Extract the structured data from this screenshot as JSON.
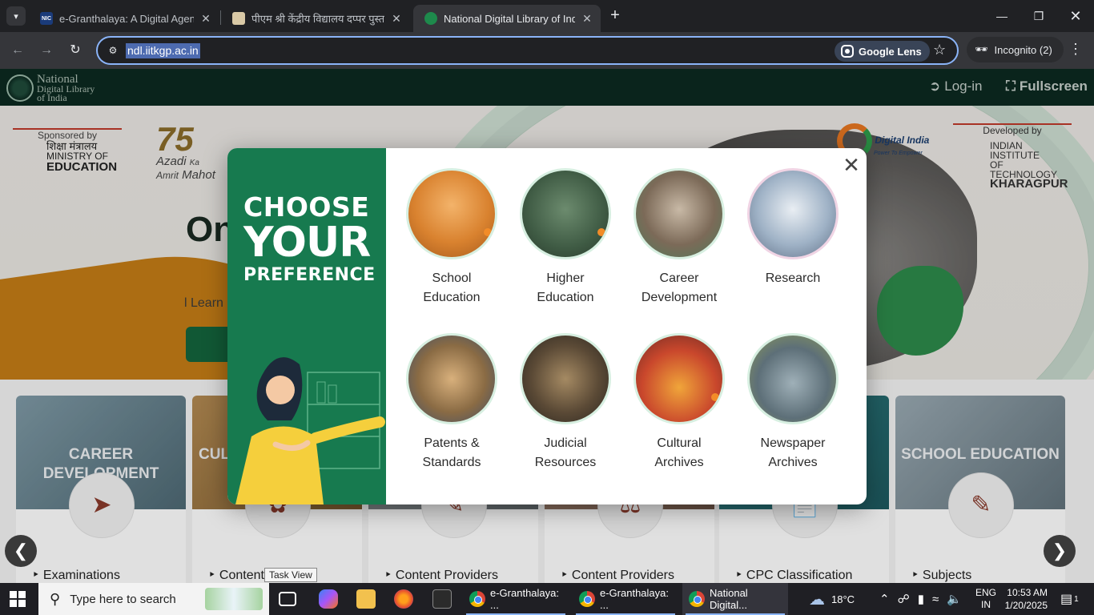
{
  "tabs": [
    {
      "title": "e-Granthalaya: A Digital Agenda",
      "favicon_text": "NIC",
      "favicon_color": "#1a3b7a"
    },
    {
      "title": "पीएम श्री केंद्रीय विद्यालय दप्पर पुस्तकालय",
      "favicon_text": "",
      "favicon_color": "#d9c9a6"
    },
    {
      "title": "National Digital Library of India",
      "favicon_text": "",
      "favicon_color": "#1e8a4c"
    }
  ],
  "address_bar": {
    "url": "ndl.iitkgp.ac.in",
    "lens_label": "Google Lens",
    "incognito_label": "Incognito (2)"
  },
  "site_header": {
    "logo_lines": [
      "National",
      "Digital Library",
      "of India"
    ],
    "login_label": "Log-in",
    "fullscreen_label": "Fullscreen"
  },
  "hero": {
    "sponsored_by": "Sponsored by",
    "ministry_hindi": "शिक्षा मंत्रालय",
    "ministry_line1": "MINISTRY OF",
    "ministry_line2": "EDUCATION",
    "azadi_lines": [
      "Azadi",
      "Amrit",
      "Ka",
      "Mahot"
    ],
    "digital_india": "Digital India",
    "digital_india_tag": "Power To Empower",
    "developed_by": "Developed by",
    "iit_line1": "INDIAN INSTITUTE",
    "iit_line2": "OF TECHNOLOGY",
    "iit_line3": "KHARAGPUR",
    "title_partial": "On",
    "subtitle_partial": "l Learn"
  },
  "modal": {
    "heading_line1": "CHOOSE",
    "heading_line2": "YOUR",
    "heading_line3": "PREFERENCE",
    "options": [
      {
        "label_1": "School",
        "label_2": "Education"
      },
      {
        "label_1": "Higher",
        "label_2": "Education"
      },
      {
        "label_1": "Career",
        "label_2": "Development"
      },
      {
        "label_1": "Research",
        "label_2": ""
      },
      {
        "label_1": "Patents &",
        "label_2": "Standards"
      },
      {
        "label_1": "Judicial",
        "label_2": "Resources"
      },
      {
        "label_1": "Cultural",
        "label_2": "Archives"
      },
      {
        "label_1": "Newspaper",
        "label_2": "Archives"
      }
    ]
  },
  "cards": [
    {
      "title_1": "CAREER",
      "title_2": "DEVELOPMENT",
      "link": "Examinations"
    },
    {
      "title_1": "CUL",
      "title_2": "",
      "link": "Content"
    },
    {
      "title_1": "",
      "title_2": "",
      "link": "Content Providers"
    },
    {
      "title_1": "",
      "title_2": "",
      "link": "Content Providers"
    },
    {
      "title_1": "",
      "title_2": "",
      "link": "CPC Classification"
    },
    {
      "title_1": "SCHOOL EDUCATION",
      "title_2": "",
      "link": "Subjects"
    }
  ],
  "tooltip": "Task View",
  "taskbar": {
    "search_placeholder": "Type here to search",
    "apps": [
      "e-Granthalaya: ...",
      "e-Granthalaya: ...",
      "National Digital..."
    ],
    "weather": "18°C",
    "lang_1": "ENG",
    "lang_2": "IN",
    "time": "10:53 AM",
    "date": "1/20/2025",
    "notif_count": "1"
  }
}
